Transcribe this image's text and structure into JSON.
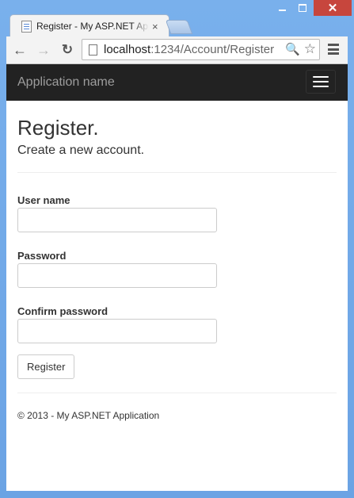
{
  "window": {
    "minimize_icon": "minimize-icon",
    "maximize_icon": "maximize-icon",
    "close_glyph": "✕"
  },
  "tab": {
    "title": "Register - My ASP.NET Application",
    "close_glyph": "×"
  },
  "toolbar": {
    "back_glyph": "←",
    "forward_glyph": "→",
    "reload_glyph": "↻",
    "url_host": "localhost",
    "url_path": ":1234/Account/Register",
    "search_glyph": "🔍",
    "star_glyph": "☆"
  },
  "navbar": {
    "brand": "Application name"
  },
  "page": {
    "title": "Register.",
    "subtitle": "Create a new account.",
    "form": {
      "username_label": "User name",
      "username_value": "",
      "password_label": "Password",
      "password_value": "",
      "confirm_label": "Confirm password",
      "confirm_value": "",
      "submit_label": "Register"
    },
    "footer": "© 2013 - My ASP.NET Application"
  },
  "colors": {
    "navbar_bg": "#222222",
    "brand_text": "#9d9d9d",
    "window_frame": "#6da7e8",
    "close_button": "#c7463d"
  }
}
